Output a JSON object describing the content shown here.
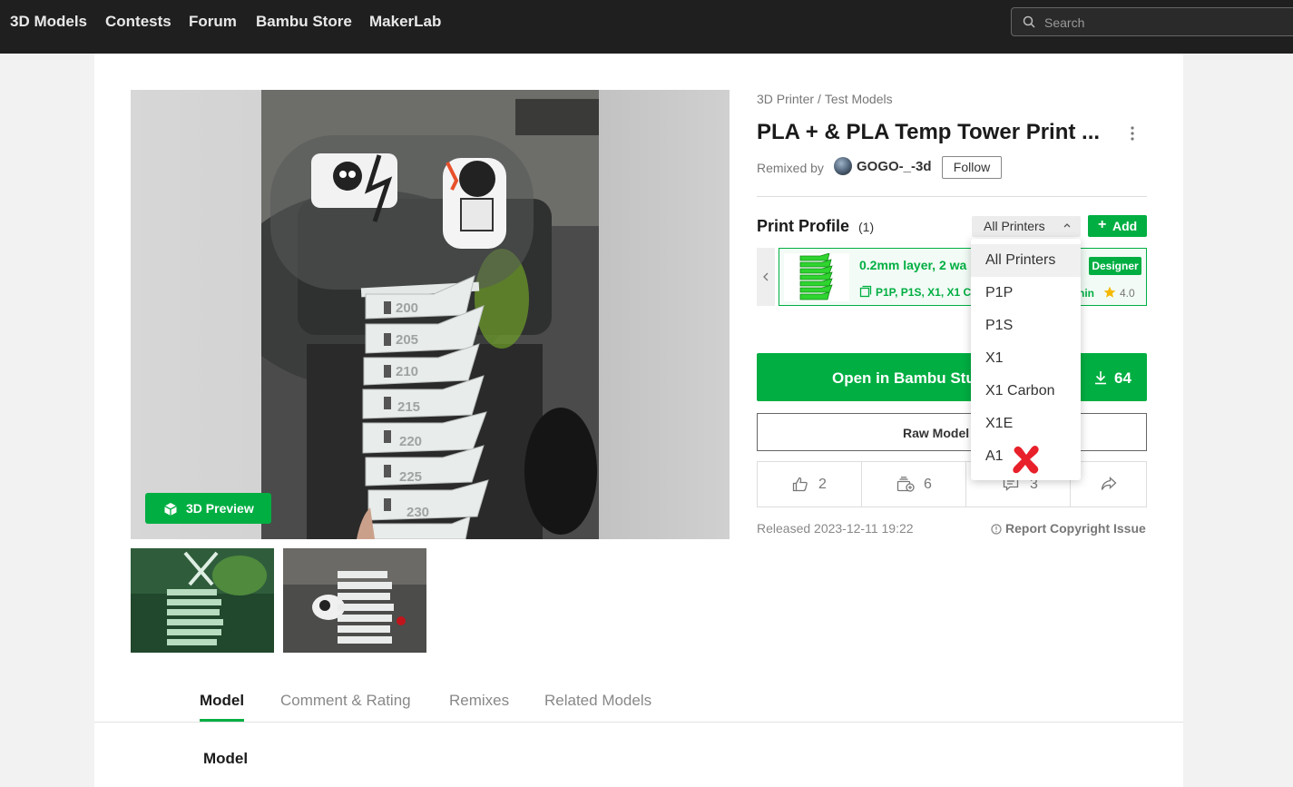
{
  "nav": {
    "items": [
      "3D Models",
      "Contests",
      "Forum",
      "Bambu Store",
      "MakerLab"
    ],
    "search_placeholder": "Search"
  },
  "gallery": {
    "preview_button": "3D Preview",
    "tower_labels": [
      "200",
      "205",
      "210",
      "215",
      "220",
      "225",
      "230"
    ]
  },
  "model": {
    "breadcrumb": [
      "3D Printer",
      "Test Models"
    ],
    "breadcrumb_sep": "/",
    "title": "PLA + & PLA Temp Tower Print ...",
    "remixed_by": "Remixed by",
    "author": "GOGO-_-3d",
    "follow": "Follow"
  },
  "print_profile": {
    "label": "Print Profile",
    "count": "(1)",
    "printer_filter": "All Printers",
    "add": "Add",
    "card": {
      "title": "0.2mm layer, 2 wa",
      "printers": "P1P, P1S, X1, X1 C",
      "badge": "Designer",
      "time": "nin",
      "rating": "4.0"
    }
  },
  "dropdown": {
    "options": [
      "All Printers",
      "P1P",
      "P1S",
      "X1",
      "X1 Carbon",
      "X1E",
      "A1"
    ],
    "selected_index": 0
  },
  "buttons": {
    "open": "Open in Bambu Stu",
    "download_count": "64",
    "raw_model": "Raw Model"
  },
  "stats": {
    "likes": "2",
    "collections": "6",
    "comments": "3"
  },
  "meta": {
    "released": "Released 2023-12-11 19:22",
    "report": "Report Copyright Issue"
  },
  "tabs": [
    "Model",
    "Comment & Rating",
    "Remixes",
    "Related Models"
  ],
  "section": {
    "title": "Model"
  },
  "colors": {
    "accent": "#00ae42",
    "nav_bg": "#1f1f1f",
    "mark": "#e8202a"
  }
}
